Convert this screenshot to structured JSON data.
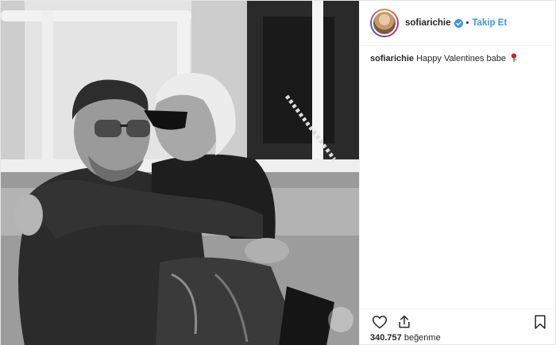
{
  "post": {
    "username": "sofiarichie",
    "follow_label": "Takip Et",
    "separator": "•",
    "caption": {
      "user": "sofiarichie",
      "text": "Happy Valentines babe"
    },
    "likes": {
      "count": "340.757",
      "label": "beğenme"
    }
  },
  "icons": {
    "verified": "verified-badge-icon",
    "like": "heart-icon",
    "share": "share-icon",
    "bookmark": "bookmark-icon",
    "caption_emoji": "rose-icon"
  },
  "colors": {
    "accent": "#3897f0",
    "text": "#262626",
    "border": "#efefef"
  }
}
